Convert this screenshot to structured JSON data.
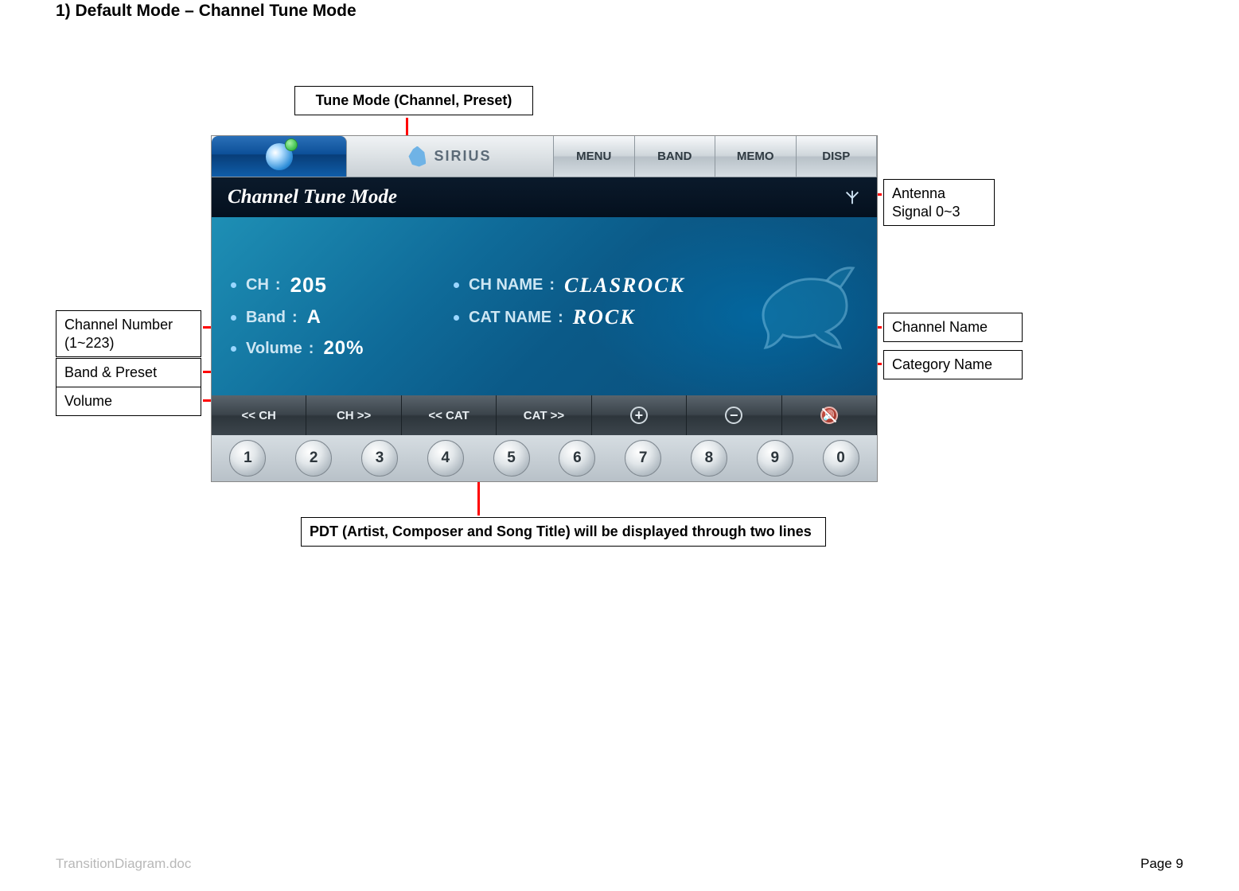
{
  "page": {
    "title": "1) Default Mode – Channel Tune Mode",
    "doc_name": "TransitionDiagram.doc",
    "page_number": "Page 9"
  },
  "callouts": {
    "tune_mode": "Tune Mode (Channel, Preset)",
    "antenna": "Antenna Signal 0~3",
    "channel_number": "Channel Number (1~223)",
    "band_preset": "Band & Preset",
    "volume": "Volume",
    "channel_name": "Channel Name",
    "category_name": "Category Name",
    "pdt": "PDT (Artist, Composer and Song Title) will be displayed through two lines"
  },
  "device": {
    "topbar": {
      "sirius_label": "SIRIUS",
      "buttons": [
        "MENU",
        "BAND",
        "MEMO",
        "DISP"
      ]
    },
    "mode_title": "Channel Tune Mode",
    "info": {
      "ch_label": "CH",
      "ch_value": "205",
      "band_label": "Band",
      "band_value": "A",
      "volume_label": "Volume",
      "volume_value": "20%",
      "chname_label": "CH NAME",
      "chname_value": "CLASROCK",
      "catname_label": "CAT NAME",
      "catname_value": "ROCK"
    },
    "ctrlbar": {
      "ch_prev": "<< CH",
      "ch_next": "CH >>",
      "cat_prev": "<< CAT",
      "cat_next": "CAT >>",
      "vol_up_icon": "plus-icon",
      "vol_down_icon": "minus-icon",
      "mute_icon": "mute-icon"
    },
    "numpad": [
      "1",
      "2",
      "3",
      "4",
      "5",
      "6",
      "7",
      "8",
      "9",
      "0"
    ]
  }
}
